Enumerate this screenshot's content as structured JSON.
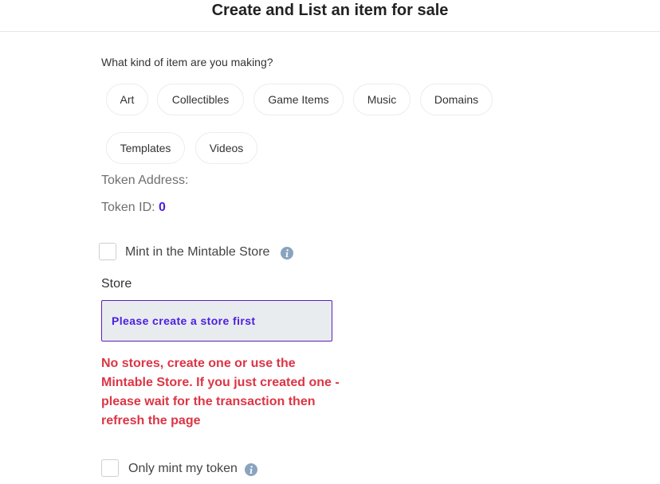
{
  "header": {
    "title": "Create and List an item for sale"
  },
  "item_kind": {
    "question": "What kind of item are you making?",
    "options": [
      "Art",
      "Collectibles",
      "Game Items",
      "Music",
      "Domains",
      "Templates",
      "Videos"
    ]
  },
  "token": {
    "address_label": "Token Address:",
    "address_value": "",
    "id_label": "Token ID:",
    "id_value": "0"
  },
  "mint_store": {
    "label": "Mint in the Mintable Store",
    "checked": false,
    "icon": "info-icon"
  },
  "store": {
    "label": "Store",
    "selected": "Please create a store first",
    "error": "No stores, create one or use the Mintable Store. If you just created one - please wait for the transaction then refresh the page"
  },
  "only_mint": {
    "label": "Only mint my token",
    "checked": false,
    "icon": "info-icon"
  },
  "colors": {
    "accent": "#4b1fe0",
    "border_accent": "#5b21b6",
    "error": "#dc3545",
    "info_icon": "#8aa4bf"
  }
}
